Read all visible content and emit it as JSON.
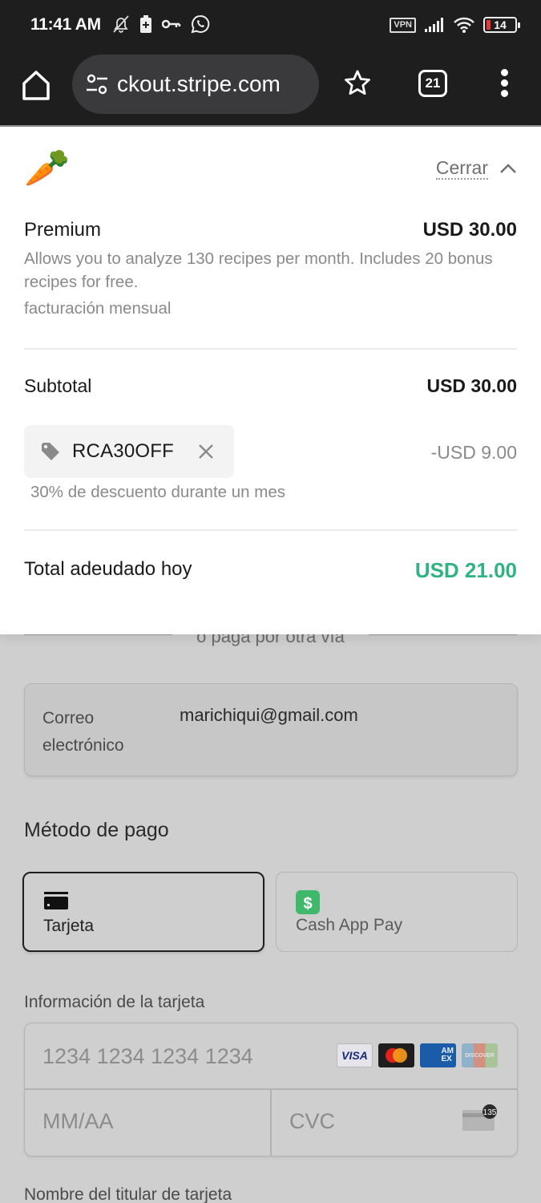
{
  "status_bar": {
    "time": "11:41 AM",
    "left_icons": [
      "bell-off-icon",
      "battery-saver-icon",
      "key-icon",
      "whatsapp-icon"
    ],
    "vpn_label": "VPN",
    "battery_level": "14"
  },
  "browser": {
    "url": "ckout.stripe.com",
    "tab_count": "21"
  },
  "summary": {
    "close_label": "Cerrar",
    "product": {
      "name": "Premium",
      "price": "USD 30.00",
      "description": "Allows you to analyze 130 recipes per month. Includes 20 bonus recipes for free.",
      "billing": "facturación mensual"
    },
    "subtotal": {
      "label": "Subtotal",
      "value": "USD 30.00"
    },
    "promo": {
      "code": "RCA30OFF",
      "discount": "-USD 9.00",
      "description": "30% de descuento durante un mes"
    },
    "total": {
      "label": "Total adeudado hoy",
      "value": "USD 21.00",
      "color": "#30b383"
    }
  },
  "form": {
    "or_separator": "o paga por otra vía",
    "email": {
      "label": "Correo electrónico",
      "value": "marichiqui@gmail.com"
    },
    "payment_method": {
      "title": "Método de pago",
      "options": [
        {
          "label": "Tarjeta",
          "icon": "credit-card-icon",
          "selected": true
        },
        {
          "label": "Cash App Pay",
          "icon": "cash-app-icon",
          "selected": false
        }
      ]
    },
    "card_info": {
      "label": "Información de la tarjeta",
      "number_placeholder": "1234 1234 1234 1234",
      "expiry_placeholder": "MM/AA",
      "cvc_placeholder": "CVC",
      "brands": [
        "VISA",
        "Mastercard",
        "AMEX",
        "Discover"
      ],
      "cvc_hint": "135"
    },
    "cardholder_label": "Nombre del titular de tarjeta"
  }
}
